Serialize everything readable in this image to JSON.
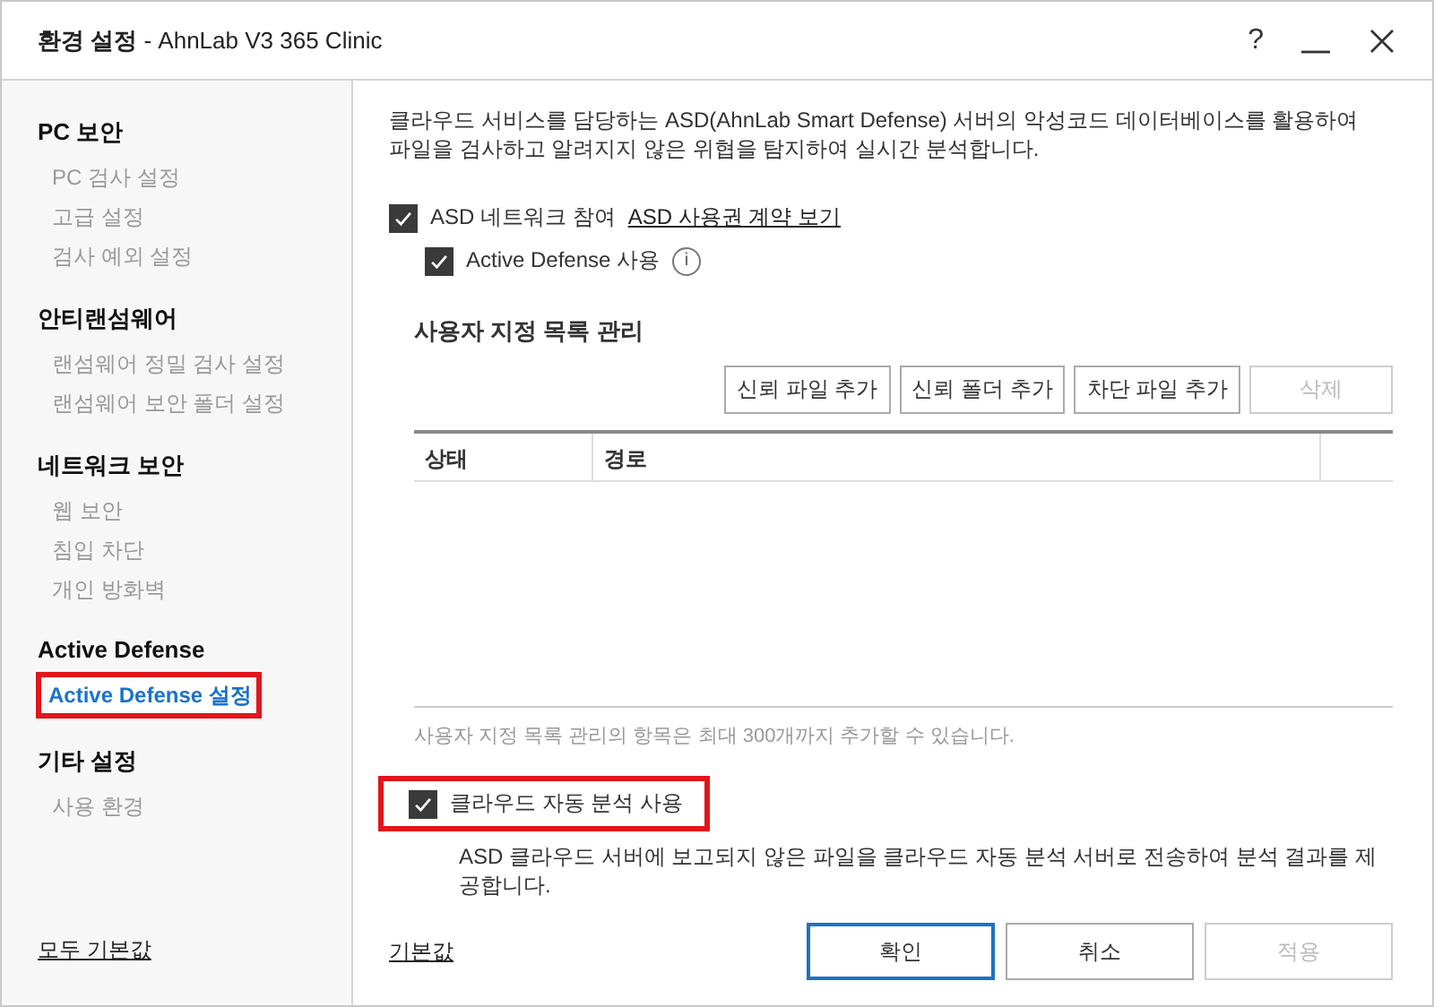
{
  "window": {
    "title": "환경 설정",
    "subtitle": "- AhnLab V3 365 Clinic",
    "controls": [
      "?"
    ]
  },
  "sidebar": {
    "groups": [
      {
        "title": "PC 보안",
        "items": [
          {
            "label": "PC 검사 설정",
            "selected": false,
            "highlighted": false
          },
          {
            "label": "고급 설정",
            "selected": false,
            "highlighted": false
          },
          {
            "label": "검사 예외 설정",
            "selected": false,
            "highlighted": false
          }
        ]
      },
      {
        "title": "안티랜섬웨어",
        "items": [
          {
            "label": "랜섬웨어 정밀 검사 설정",
            "selected": false,
            "highlighted": false
          },
          {
            "label": "랜섬웨어 보안 폴더 설정",
            "selected": false,
            "highlighted": false
          }
        ]
      },
      {
        "title": "네트워크 보안",
        "items": [
          {
            "label": "웹 보안",
            "selected": false,
            "highlighted": false
          },
          {
            "label": "침입 차단",
            "selected": false,
            "highlighted": false
          },
          {
            "label": "개인 방화벽",
            "selected": false,
            "highlighted": false
          }
        ]
      },
      {
        "title": "Active Defense",
        "items": [
          {
            "label": "Active Defense 설정",
            "selected": true,
            "highlighted": true
          }
        ]
      },
      {
        "title": "기타 설정",
        "items": [
          {
            "label": "사용 환경",
            "selected": false,
            "highlighted": false
          }
        ]
      }
    ],
    "reset_link": "모두 기본값"
  },
  "content": {
    "description": "클라우드 서비스를 담당하는 ASD(AhnLab Smart Defense) 서버의 악성코드 데이터베이스를 활용하여 파일을 검사하고 알려지지 않은 위협을 탐지하여 실시간 분석합니다.",
    "asd_option": {
      "label": "ASD 네트워크 참여",
      "checked": true,
      "link": "ASD 사용권 계약 보기"
    },
    "active_defense_option": {
      "label": "Active Defense 사용",
      "checked": true,
      "info": "i"
    },
    "list_section": {
      "title": "사용자 지정 목록 관리",
      "buttons": [
        {
          "label": "신뢰 파일 추가",
          "disabled": false
        },
        {
          "label": "신뢰 폴더 추가",
          "disabled": false
        },
        {
          "label": "차단 파일 추가",
          "disabled": false
        },
        {
          "label": "삭제",
          "disabled": true
        }
      ],
      "table": {
        "columns": [
          "상태",
          "경로"
        ]
      },
      "note": "사용자 지정 목록 관리의 항목은 최대 300개까지 추가할 수 있습니다."
    },
    "cloud_option": {
      "label": "클라우드 자동 분석 사용",
      "checked": true,
      "highlighted": true,
      "description": "ASD 클라우드 서버에 보고되지 않은 파일을 클라우드 자동 분석 서버로 전송하여 분석 결과를 제공합니다."
    }
  },
  "footer": {
    "default_link": "기본값",
    "buttons": [
      {
        "label": "확인",
        "kind": "primary",
        "disabled": false
      },
      {
        "label": "취소",
        "kind": "normal",
        "disabled": false
      },
      {
        "label": "적용",
        "kind": "normal",
        "disabled": true
      }
    ]
  }
}
